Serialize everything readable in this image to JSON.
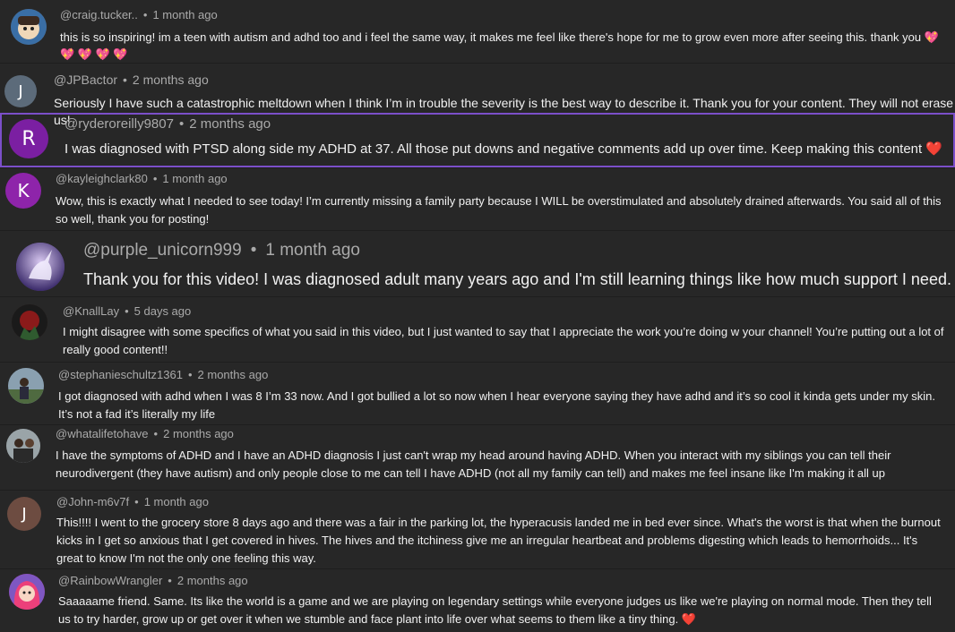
{
  "comments": [
    {
      "handle": "@craig.tucker..",
      "time": "1 month ago",
      "text": "this is so inspiring! im a teen with autism and adhd too and i feel the same way, it makes me feel like there's hope for me to grow even more after seeing this. thank you",
      "emoji": "💖 💖 💖 💖 💖",
      "avatar": "cartoon",
      "avatar_color": "#6b5a4a"
    },
    {
      "handle": "@JPBactor",
      "time": "2 months ago",
      "text": "Seriously I have such a catastrophic meltdown when I think I’m in trouble the severity is the best way to describe it. Thank you for your content. They will not erase us!",
      "avatar_letter": "J",
      "avatar_color": "#5c6b7a"
    },
    {
      "handle": "@ryderoreilly9807",
      "time": "2 months ago",
      "text": "I was diagnosed with PTSD along side my ADHD at 37. All those put downs and negative comments add up over time. Keep making this content",
      "emoji": "❤️",
      "avatar_letter": "R",
      "avatar_color": "#7b1fa2"
    },
    {
      "handle": "@kayleighclark80",
      "time": "1 month ago",
      "text": "Wow, this is exactly what I needed to see today! I’m currently missing a family party because I WILL be overstimulated and absolutely drained afterwards. You said all of this so well, thank you for posting!",
      "avatar_letter": "K",
      "avatar_color": "#8e24aa"
    },
    {
      "handle": "@purple_unicorn999",
      "time": "1 month ago",
      "text": "Thank you for this video! I was diagnosed adult many years ago and I'm still learning things like how much support I need.",
      "avatar": "unicorn",
      "avatar_color": "#5b3f8c"
    },
    {
      "handle": "@KnallLay",
      "time": "5 days ago",
      "text": "I might disagree with some specifics of what you said in this video, but I just wanted to say that I appreciate the work you’re doing w your channel! You’re putting out a lot of really good content!!",
      "avatar": "photo",
      "avatar_color": "#3d2a24"
    },
    {
      "handle": "@stephanieschultz1361",
      "time": "2 months ago",
      "text": "I got diagnosed with adhd when I was 8 I’m 33 now. And I got bullied a lot so now when I hear everyone saying they have adhd and it’s so cool it kinda gets under my skin. It’s not a fad it’s literally my life",
      "avatar": "photo",
      "avatar_color": "#4a5a6a"
    },
    {
      "handle": "@whatalifetohave",
      "time": "2 months ago",
      "text": "I have the symptoms of ADHD and I have an ADHD diagnosis I just can't wrap my head around having ADHD. When you interact with my siblings you can tell their neurodivergent (they have autism) and only people close to me can tell I have ADHD (not all my family can tell) and makes me feel insane like I'm making it all up",
      "avatar": "photo",
      "avatar_color": "#555"
    },
    {
      "handle": "@John-m6v7f",
      "time": "1 month ago",
      "text": "This!!!! I went to the grocery store 8 days ago and there was a fair in the parking lot, the hyperacusis landed me in bed ever since. What's the worst is that when the burnout kicks in I get so anxious that I get covered in hives. The hives and the itchiness give me an irregular heartbeat and problems digesting which leads to hemorrhoids... It's great to know I'm not the only one feeling this way.",
      "avatar_letter": "J",
      "avatar_color": "#6d4c41"
    },
    {
      "handle": "@RainbowWrangler",
      "time": "2 months ago",
      "text": "Saaaaame friend. Same. Its like the world is a game and we are playing on legendary settings while everyone judges us like we're playing on normal mode. Then they tell us to try harder, grow up or get over it when we stumble and face plant into life over what seems to them like a tiny thing.",
      "emoji": "❤️",
      "avatar": "cartoon",
      "avatar_color": "#c2185b"
    }
  ]
}
